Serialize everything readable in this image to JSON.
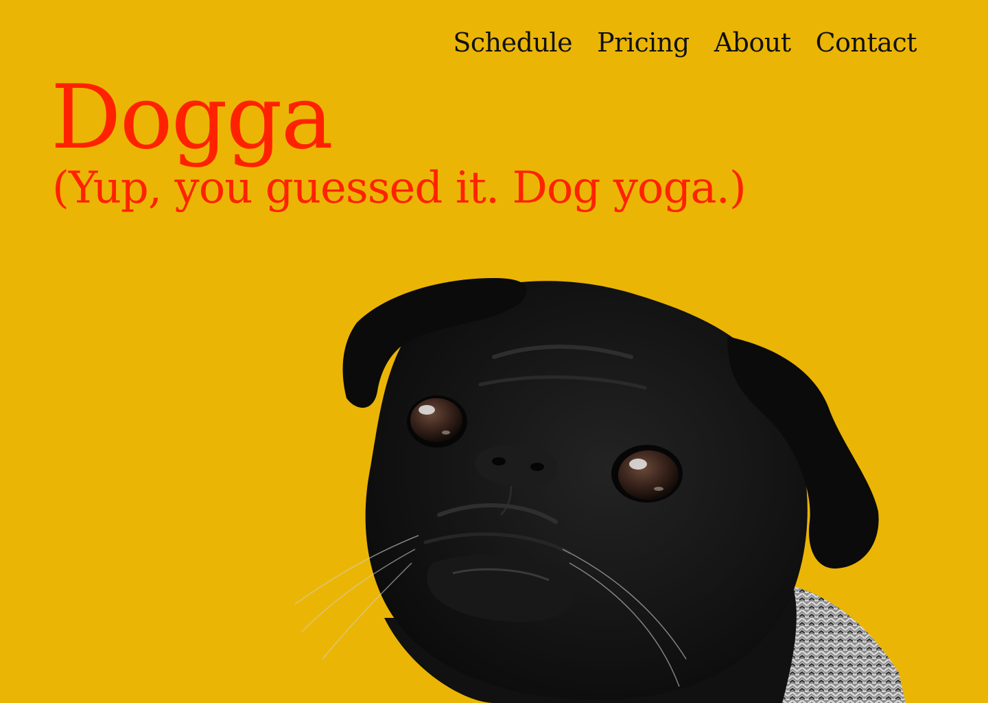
{
  "nav": {
    "items": [
      {
        "label": "Schedule"
      },
      {
        "label": "Pricing"
      },
      {
        "label": "About"
      },
      {
        "label": "Contact"
      }
    ]
  },
  "hero": {
    "title": "Dogga",
    "subtitle": "(Yup, you guessed it. Dog yoga.)"
  },
  "colors": {
    "background": "#EBB505",
    "accent": "#FF2200",
    "nav_text": "#111111",
    "dog_fur": "#141414"
  },
  "image": {
    "subject": "black pug wearing knitted sweater"
  }
}
